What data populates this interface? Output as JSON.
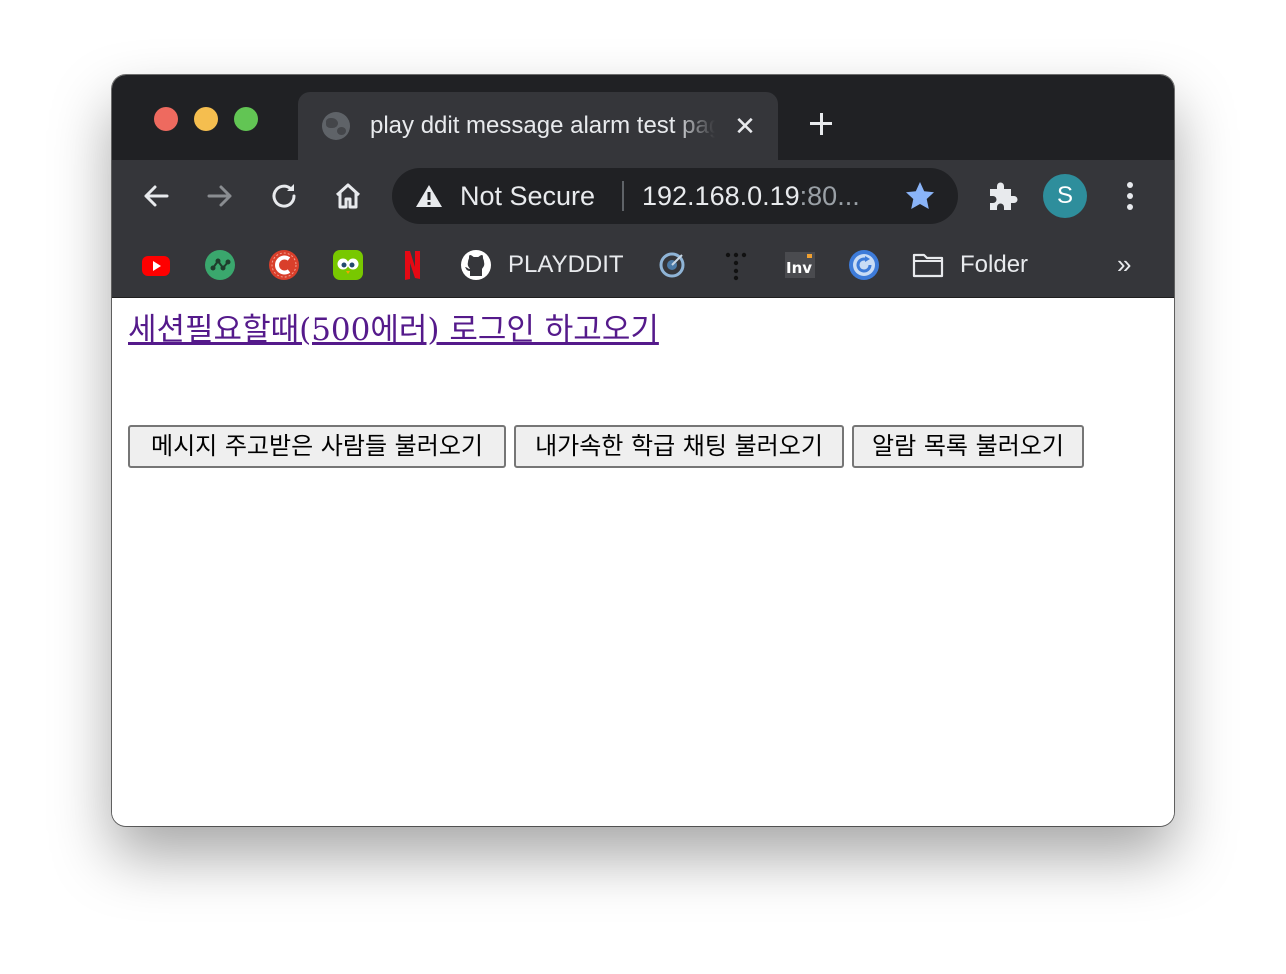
{
  "browser": {
    "tab": {
      "title": "play ddit message alarm test page",
      "close_glyph": "✕",
      "favicon": "globe-icon"
    },
    "new_tab_icon": "plus-icon",
    "toolbar": {
      "back_icon": "back-arrow-icon",
      "forward_icon": "forward-arrow-icon",
      "reload_icon": "reload-icon",
      "home_icon": "home-icon",
      "security_label": "Not Secure",
      "url_host": "192.168.0.19",
      "url_rest": ":80...",
      "bookmark_star_color": "#8ab4f8",
      "extensions_icon": "puzzle-icon",
      "profile_initial": "S",
      "profile_color": "#2e8e9c",
      "menu_icon": "kebab-menu-icon"
    },
    "bookmarks": {
      "items": [
        {
          "icon": "youtube-icon"
        },
        {
          "icon": "green-network-icon"
        },
        {
          "icon": "red-c-icon"
        },
        {
          "icon": "duolingo-icon"
        },
        {
          "icon": "netflix-icon"
        },
        {
          "icon": "github-icon",
          "label": "PLAYDDIT"
        },
        {
          "icon": "target-icon"
        },
        {
          "icon": "dots-icon"
        },
        {
          "icon": "inv-icon"
        },
        {
          "icon": "blue-refresh-icon"
        },
        {
          "icon": "folder-icon",
          "label": "Folder"
        }
      ],
      "overflow_label": "»"
    }
  },
  "page": {
    "session_link": "세션필요할때(500에러) 로그인 하고오기",
    "buttons": [
      "메시지 주고받은 사람들 불러오기",
      "내가속한 학급 채팅 불러오기",
      "알람 목록 불러오기"
    ],
    "link_color": "#551a8b"
  }
}
